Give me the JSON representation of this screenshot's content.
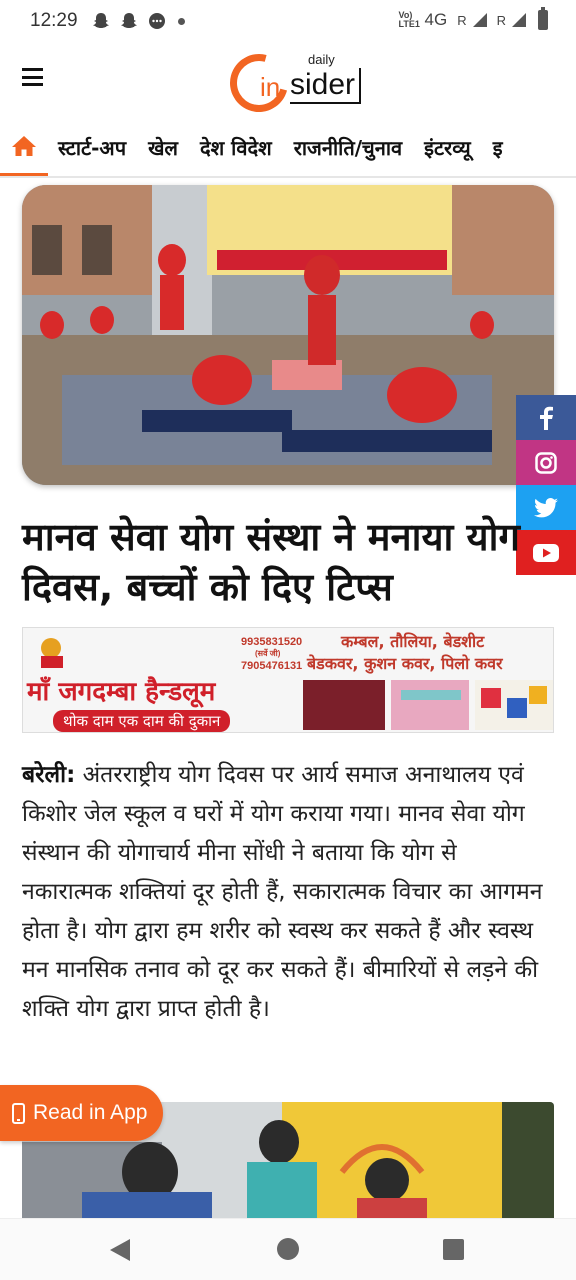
{
  "status_bar": {
    "time": "12:29",
    "network": "4G",
    "volte": "Vo) LTE1",
    "roaming_1": "R",
    "roaming_2": "R"
  },
  "header": {
    "logo_daily": "daily",
    "logo_in": "in",
    "logo_sider": "sider"
  },
  "nav": {
    "items": [
      "स्टार्ट-अप",
      "खेल",
      "देश विदेश",
      "राजनीति/चुनाव",
      "इंटरव्यू",
      "इ"
    ]
  },
  "social": [
    "facebook-icon",
    "instagram-icon",
    "twitter-icon",
    "youtube-icon"
  ],
  "article": {
    "headline": "मानव सेवा योग संस्था ने मनाया योग दिवस, बच्चों को दिए टिप्स",
    "dateline": "बरेली:",
    "body": " अंतरराष्ट्रीय योग दिवस पर आर्य समाज अनाथालय एवं किशोर जेल स्कूल व घरों में योग कराया गया। मानव सेवा योग संस्थान की योगाचार्य मीना सोंधी ने बताया कि योग से नकारात्मक शक्तियां दूर होती हैं, सकारात्मक विचार का आगमन होता है। योग द्वारा हम शरीर को स्वस्थ कर सकते हैं और स्वस्थ मन मानसिक तनाव को दूर कर सकते हैं। बीमारियों से लड़ने की शक्ति योग द्वारा प्राप्त होती है।"
  },
  "ad": {
    "phone_1": "9935831520",
    "phone_note": "(सर्वे जी)",
    "phone_2": "7905476131",
    "shop_name": "माँ जगदम्बा हैन्डलूम",
    "tagline": "थोक दाम एक दाम की दुकान",
    "products_line1": "कम्बल, तौलिया, बेडशीट",
    "products_line2": "बेडकवर, कुशन कवर, पिलो कवर"
  },
  "read_in_app": "Read in App",
  "colors": {
    "accent": "#f26522",
    "facebook": "#3b5998",
    "instagram": "#c13584",
    "twitter": "#1da1f2",
    "youtube": "#e02020"
  }
}
